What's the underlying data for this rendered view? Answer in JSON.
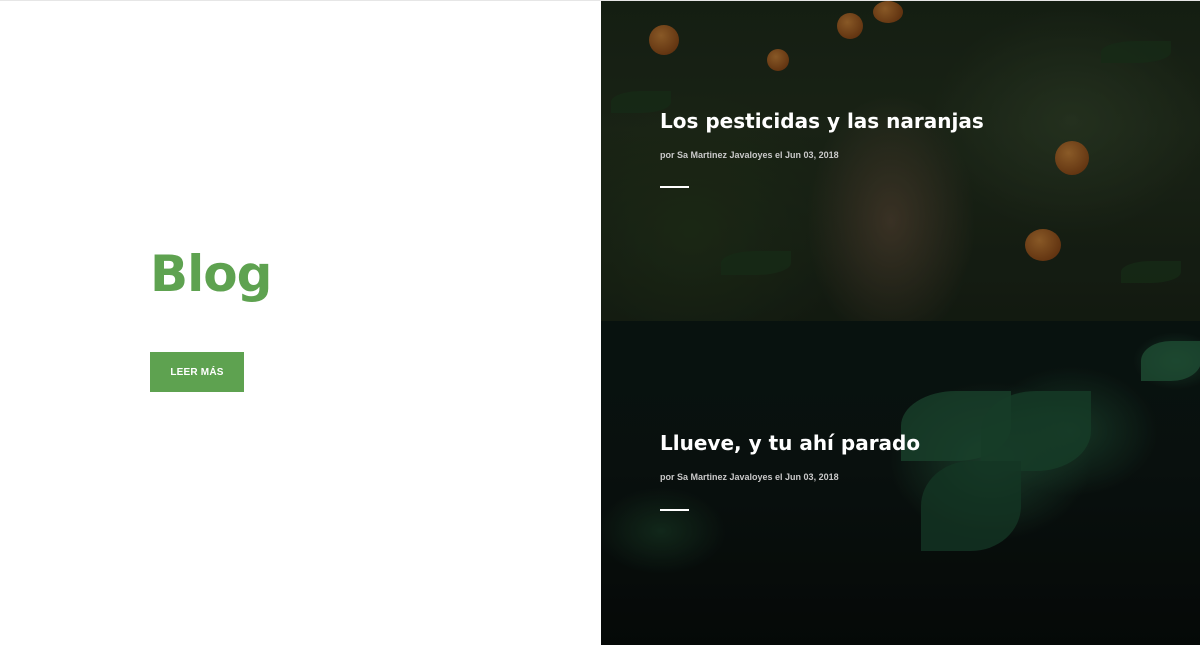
{
  "hero": {
    "title": "Blog",
    "button_label": "LEER MÁS"
  },
  "posts": [
    {
      "title": "Los pesticidas y las naranjas",
      "meta": "por Sa Martinez Javaloyes el Jun 03, 2018"
    },
    {
      "title": "Llueve, y tu ahí parado",
      "meta": "por Sa Martinez Javaloyes el Jun 03, 2018"
    }
  ],
  "colors": {
    "accent": "#5ea250",
    "post_text": "#ffffff",
    "meta_text": "#c9c9c9"
  }
}
